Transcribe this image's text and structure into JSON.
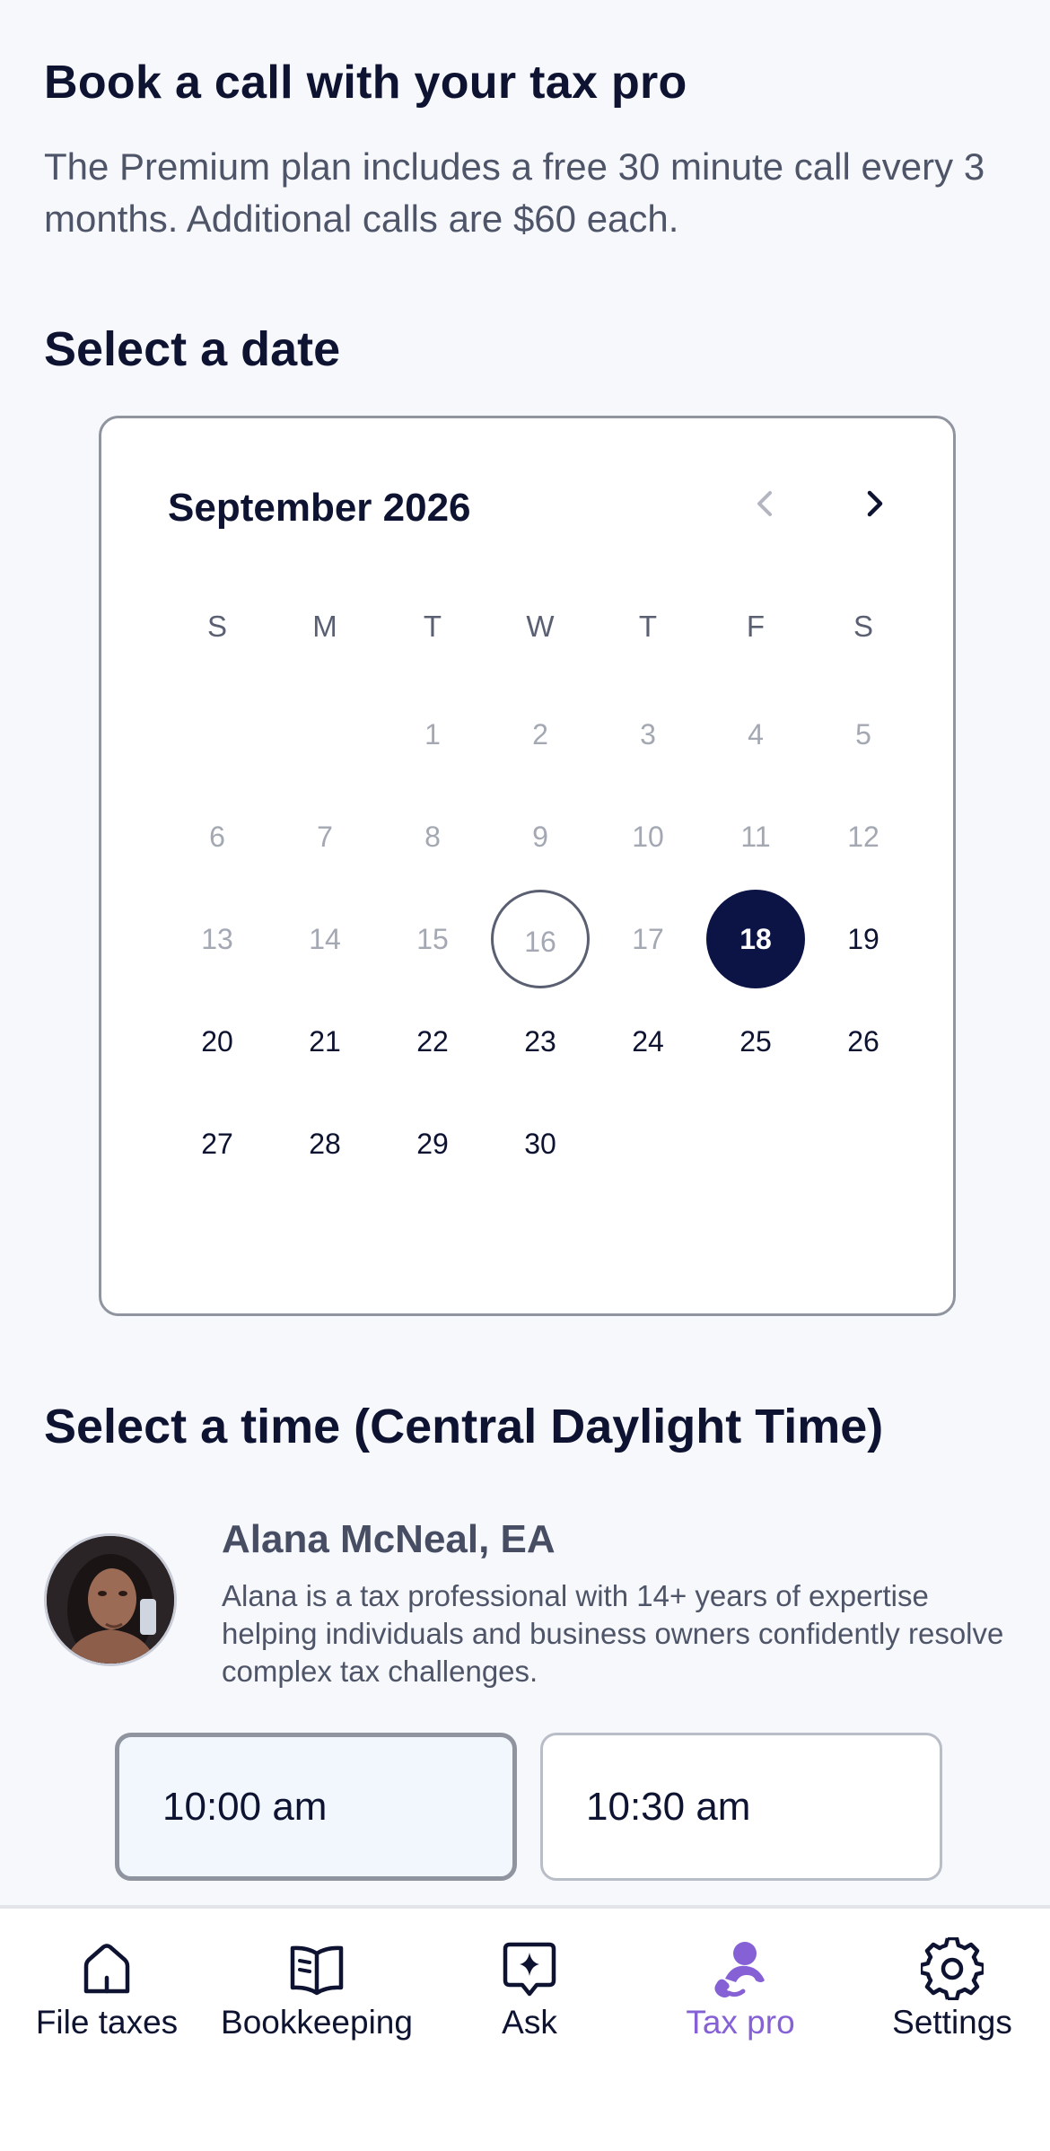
{
  "header": {
    "title": "Book a call with your tax pro",
    "intro": "The Premium plan includes a free 30 minute call every 3 months. Additional calls are $60 each."
  },
  "date_section": {
    "heading": "Select a date",
    "calendar": {
      "month_label": "September 2026",
      "weekdays": [
        "S",
        "M",
        "T",
        "W",
        "T",
        "F",
        "S"
      ],
      "days": [
        {
          "n": "1",
          "state": "past"
        },
        {
          "n": "2",
          "state": "past"
        },
        {
          "n": "3",
          "state": "past"
        },
        {
          "n": "4",
          "state": "past"
        },
        {
          "n": "5",
          "state": "past"
        },
        {
          "n": "6",
          "state": "past"
        },
        {
          "n": "7",
          "state": "past"
        },
        {
          "n": "8",
          "state": "past"
        },
        {
          "n": "9",
          "state": "past"
        },
        {
          "n": "10",
          "state": "past"
        },
        {
          "n": "11",
          "state": "past"
        },
        {
          "n": "12",
          "state": "past"
        },
        {
          "n": "13",
          "state": "past"
        },
        {
          "n": "14",
          "state": "past"
        },
        {
          "n": "15",
          "state": "past"
        },
        {
          "n": "16",
          "state": "today"
        },
        {
          "n": "17",
          "state": "past"
        },
        {
          "n": "18",
          "state": "selected"
        },
        {
          "n": "19",
          "state": "available"
        },
        {
          "n": "20",
          "state": "available"
        },
        {
          "n": "21",
          "state": "available"
        },
        {
          "n": "22",
          "state": "available"
        },
        {
          "n": "23",
          "state": "available"
        },
        {
          "n": "24",
          "state": "available"
        },
        {
          "n": "25",
          "state": "available"
        },
        {
          "n": "26",
          "state": "available"
        },
        {
          "n": "27",
          "state": "available"
        },
        {
          "n": "28",
          "state": "available"
        },
        {
          "n": "29",
          "state": "available"
        },
        {
          "n": "30",
          "state": "available"
        }
      ],
      "prev_icon": "chevron-left-icon",
      "next_icon": "chevron-right-icon"
    }
  },
  "time_section": {
    "heading": "Select a time (Central Daylight Time)",
    "pro": {
      "name": "Alana McNeal, EA",
      "bio": "Alana is a tax professional with 14+ years of expertise helping individuals and business owners confidently resolve complex tax challenges."
    },
    "slots": [
      {
        "label": "10:00 am",
        "selected": true
      },
      {
        "label": "10:30 am",
        "selected": false
      }
    ]
  },
  "tabbar": {
    "items": [
      {
        "label": "File taxes",
        "icon": "home-icon"
      },
      {
        "label": "Bookkeeping",
        "icon": "book-icon"
      },
      {
        "label": "Ask",
        "icon": "sparkle-chat-icon"
      },
      {
        "label": "Tax pro",
        "icon": "person-phone-icon",
        "active": true
      },
      {
        "label": "Settings",
        "icon": "gear-icon"
      }
    ]
  },
  "colors": {
    "accent": "#8661d6",
    "selected_day": "#0c1446",
    "text_primary": "#0d1330",
    "text_muted": "#a4a8b3"
  }
}
